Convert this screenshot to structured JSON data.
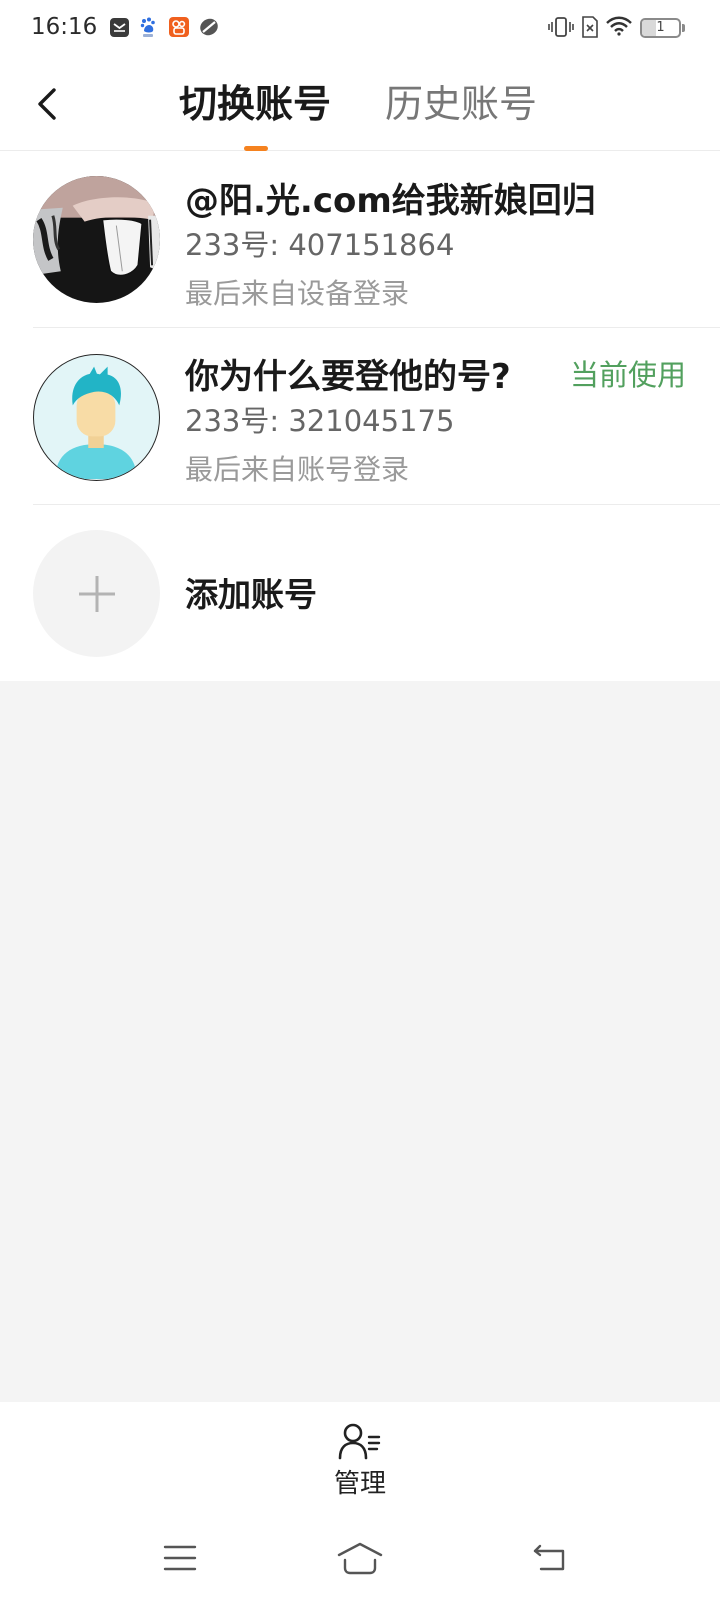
{
  "status_bar": {
    "time": "16:16",
    "battery_level": "1",
    "notification_icons": [
      "mail-app-icon",
      "baidu-paw-icon",
      "orange-app-icon",
      "sync-app-icon"
    ],
    "system_icons": [
      "vibrate-icon",
      "no-sim-icon",
      "wifi-icon",
      "battery-icon"
    ]
  },
  "header": {
    "back_icon": "chevron-left-icon",
    "tabs": [
      {
        "label": "切换账号",
        "active": true
      },
      {
        "label": "历史账号",
        "active": false
      }
    ]
  },
  "accounts": [
    {
      "name": "@阳.光.com给我新娘回归",
      "id_line": "233号: 407151864",
      "last_login": "最后来自设备登录"
    },
    {
      "name": "你为什么要登他的号?",
      "id_line": "233号: 321045175",
      "last_login": "最后来自账号登录",
      "badge": "当前使用"
    }
  ],
  "add_account": {
    "label": "添加账号",
    "icon": "plus-icon"
  },
  "bottom_bar": {
    "manage_label": "管理",
    "manage_icon": "user-list-icon"
  },
  "nav_bar": {
    "icons": [
      "menu-icon",
      "home-icon",
      "back-icon"
    ]
  },
  "colors": {
    "tab_indicator": "#f5821f",
    "current_badge": "#52a05e",
    "page_background": "#f4f4f4"
  }
}
